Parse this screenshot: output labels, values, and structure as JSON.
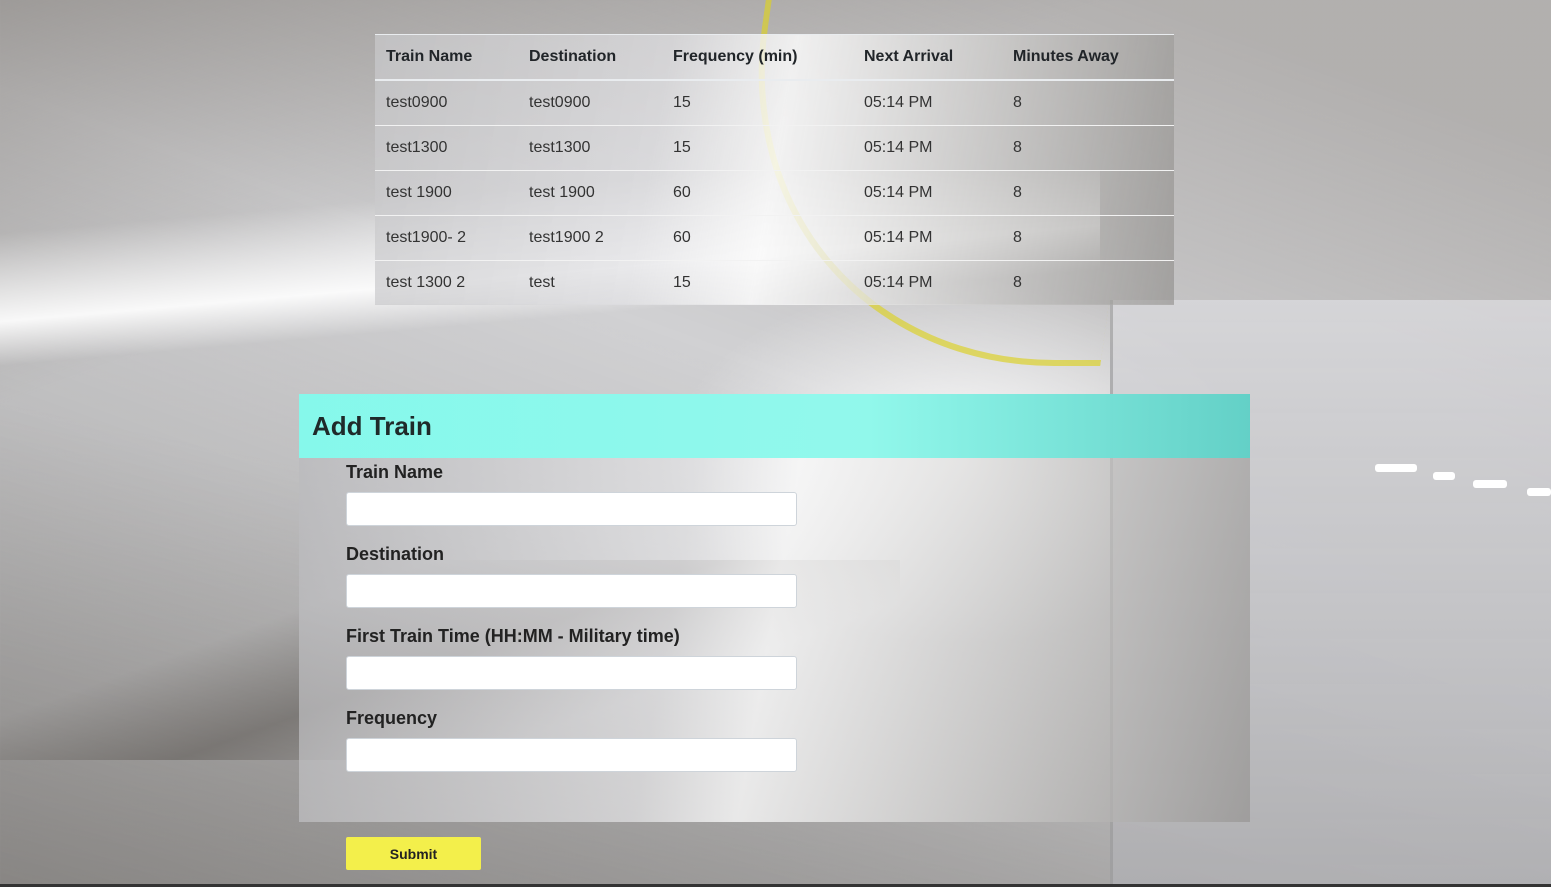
{
  "table": {
    "headers": [
      "Train Name",
      "Destination",
      "Frequency (min)",
      "Next Arrival",
      "Minutes Away"
    ],
    "rows": [
      [
        "test0900",
        "test0900",
        "15",
        "05:14 PM",
        "8"
      ],
      [
        "test1300",
        "test1300",
        "15",
        "05:14 PM",
        "8"
      ],
      [
        "test 1900",
        "test 1900",
        "60",
        "05:14 PM",
        "8"
      ],
      [
        "test1900- 2",
        "test1900 2",
        "60",
        "05:14 PM",
        "8"
      ],
      [
        "test 1300 2",
        "test",
        "15",
        "05:14 PM",
        "8"
      ]
    ]
  },
  "form": {
    "title": "Add Train",
    "fields": [
      {
        "label": "Train Name",
        "value": ""
      },
      {
        "label": "Destination",
        "value": ""
      },
      {
        "label": "First Train Time (HH:MM - Military time)",
        "value": ""
      },
      {
        "label": "Frequency",
        "value": ""
      }
    ],
    "submit_label": "Submit"
  },
  "colors": {
    "header_accent": "#8cf8eb",
    "submit_button": "#f3ef4b"
  }
}
